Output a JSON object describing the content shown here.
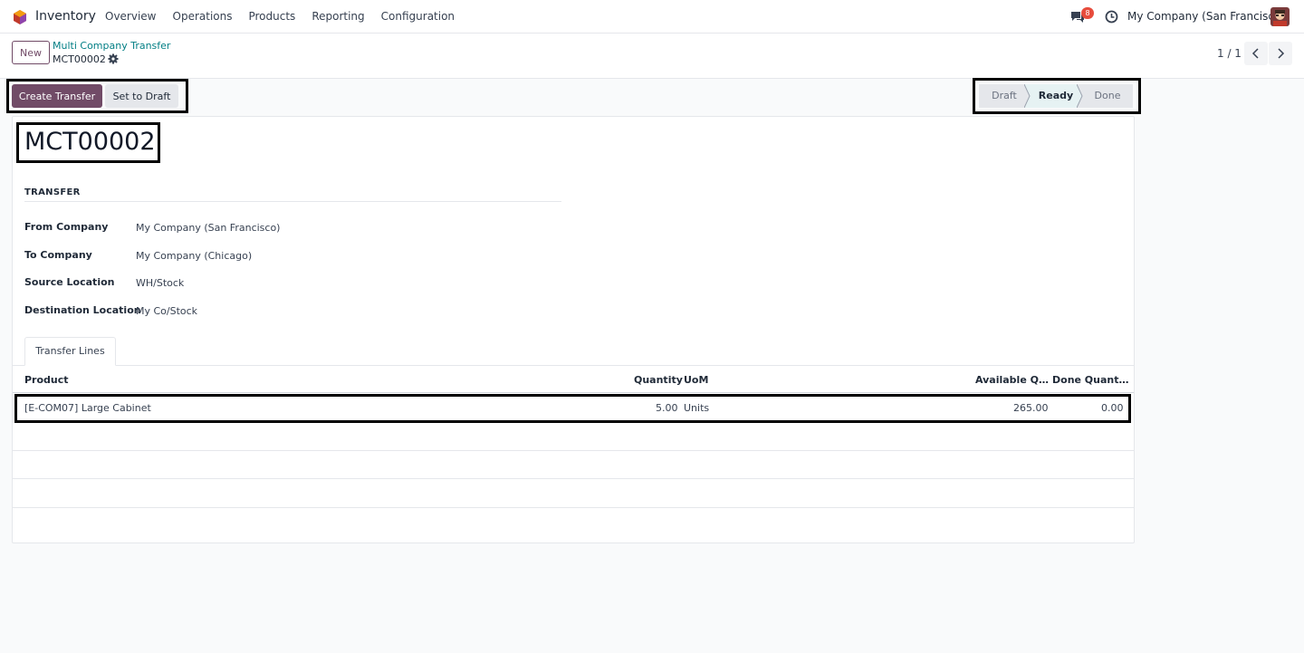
{
  "navbar": {
    "app_name": "Inventory",
    "menu": [
      "Overview",
      "Operations",
      "Products",
      "Reporting",
      "Configuration"
    ],
    "messages_count": "8",
    "company": "My Company (San Francisco)"
  },
  "control_panel": {
    "new_label": "New",
    "breadcrumb": "Multi Company Transfer",
    "record_ref": "MCT00002",
    "pager": "1 / 1"
  },
  "actions": {
    "create_transfer": "Create Transfer",
    "set_to_draft": "Set to Draft"
  },
  "status": {
    "steps": [
      "Draft",
      "Ready",
      "Done"
    ],
    "current": "Ready"
  },
  "record": {
    "title": "MCT00002",
    "group_title": "TRANSFER",
    "fields": [
      {
        "label": "From Company",
        "value": "My Company (San Francisco)"
      },
      {
        "label": "To Company",
        "value": "My Company (Chicago)"
      },
      {
        "label": "Source Location",
        "value": "WH/Stock"
      },
      {
        "label": "Destination Location",
        "value": "My Co/Stock"
      }
    ]
  },
  "tabs": [
    "Transfer Lines"
  ],
  "lines": {
    "columns": [
      "Product",
      "Quantity",
      "UoM",
      "Available Q…",
      "Done Quant…"
    ],
    "rows": [
      {
        "product": "[E-COM07] Large Cabinet",
        "quantity": "5.00",
        "uom": "Units",
        "available": "265.00",
        "done": "0.00"
      }
    ]
  },
  "colors": {
    "brand": "#714b67",
    "link": "#017e84",
    "badge": "#e74c3c"
  }
}
